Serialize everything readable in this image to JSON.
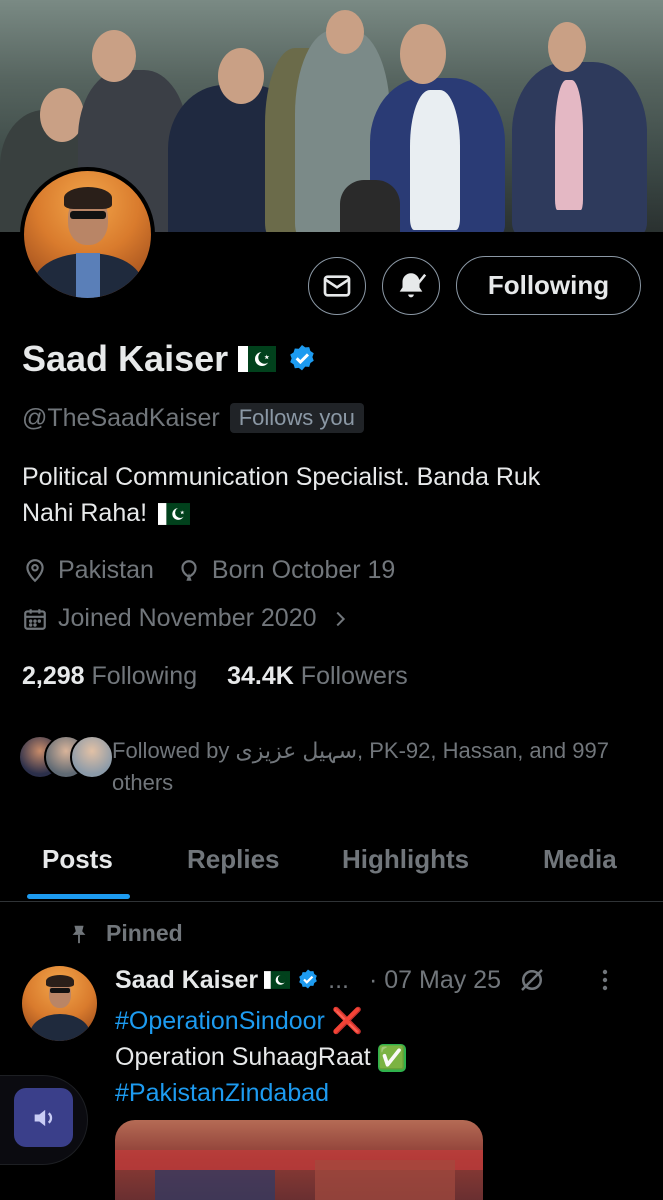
{
  "profile": {
    "name": "Saad Kaiser",
    "handle": "@TheSaadKaiser",
    "follows_you": "Follows you",
    "bio_line1": "Political Communication Specialist. Banda Ruk",
    "bio_line2": "Nahi Raha!",
    "location": "Pakistan",
    "birthday": "Born October 19",
    "joined": "Joined November 2020",
    "following_count": "2,298",
    "following_label": "Following",
    "followers_count": "34.4K",
    "followers_label": "Followers",
    "followed_by_line1": "Followed by سہیل عزیزی, PK-92, Hassan, and 997",
    "followed_by_line2": "others"
  },
  "actions": {
    "message_icon": "mail-icon",
    "notify_icon": "bell-check-icon",
    "follow_label": "Following"
  },
  "tabs": [
    {
      "label": "Posts",
      "active": true
    },
    {
      "label": "Replies",
      "active": false
    },
    {
      "label": "Highlights",
      "active": false
    },
    {
      "label": "Media",
      "active": false
    }
  ],
  "pinned_post": {
    "pinned_label": "Pinned",
    "author": "Saad Kaiser",
    "ellipsis": "...",
    "date": "· 07 May 25",
    "line1_tag": "#OperationSindoor",
    "line1_emoji": "❌",
    "line2": "Operation SuhaagRaat",
    "line2_emoji": "✅",
    "line3_tag": "#PakistanZindabad"
  },
  "colors": {
    "accent": "#1d9bf0",
    "muted": "#71767b",
    "text": "#e7e9ea",
    "background": "#000000"
  }
}
